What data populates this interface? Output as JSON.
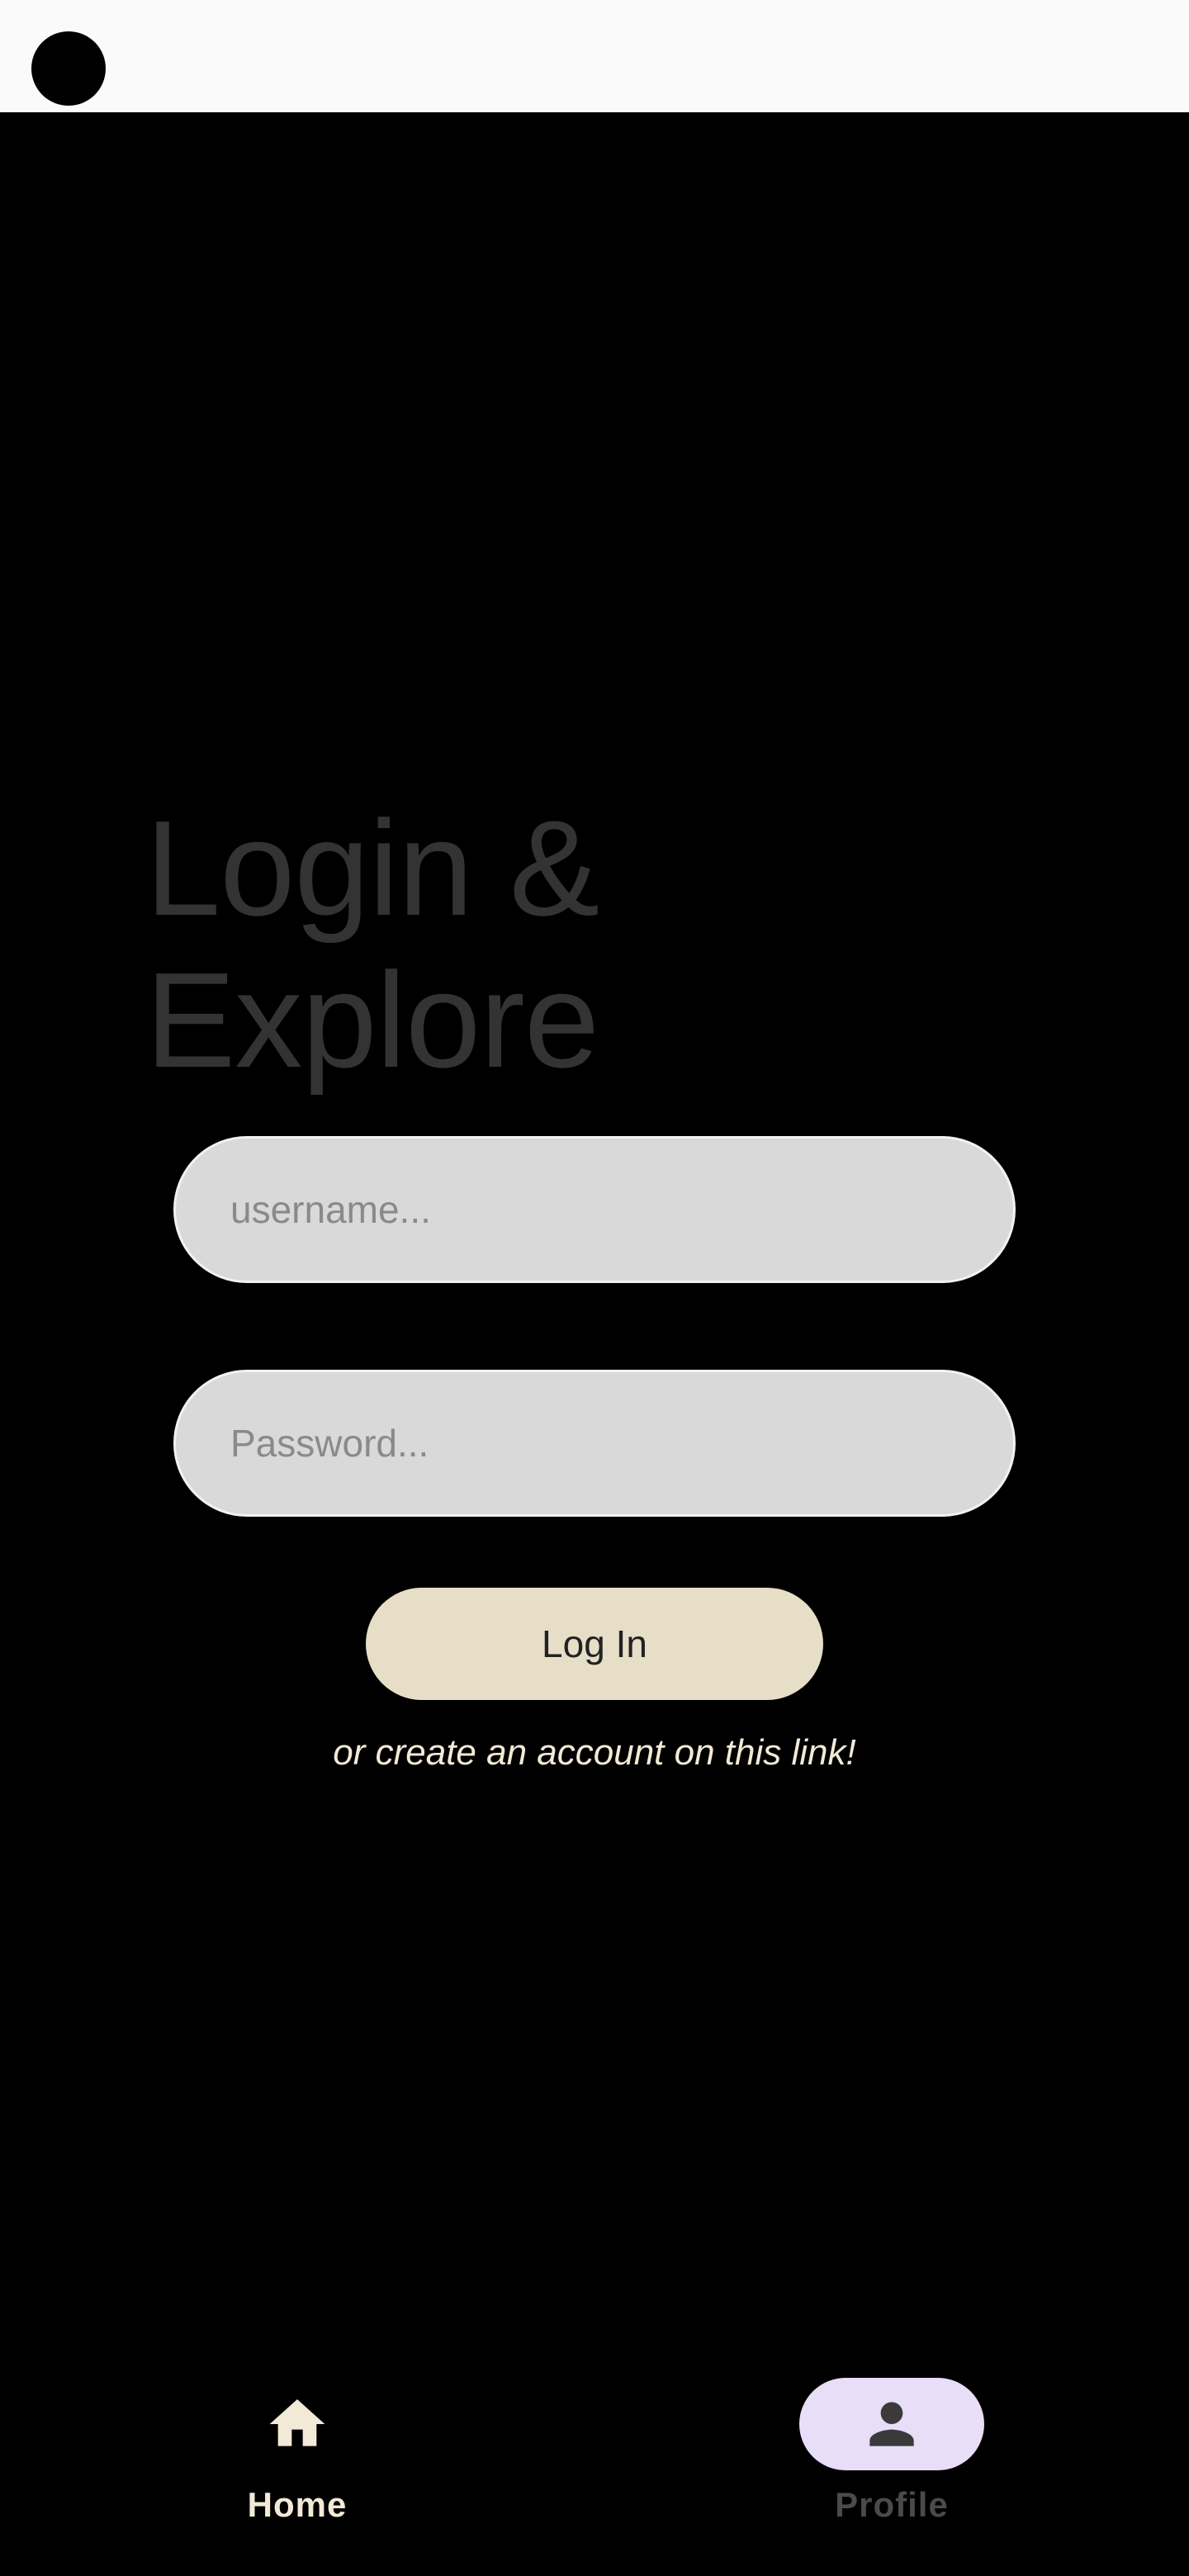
{
  "headline": {
    "line1": "Login &",
    "line2": "Explore"
  },
  "form": {
    "username_placeholder": "username...",
    "password_placeholder": "Password...",
    "login_label": "Log In",
    "signup_text": "or create an account on this link!"
  },
  "nav": {
    "items": [
      {
        "label": "Home",
        "icon": "home-icon",
        "selected": false
      },
      {
        "label": "Profile",
        "icon": "person-icon",
        "selected": true
      }
    ]
  },
  "colors": {
    "background": "#000000",
    "status_bar": "#fafafa",
    "headline": "#333333",
    "field_fill": "#d9d9d9",
    "button_fill": "#e6dec7",
    "link_text": "#f2ead6",
    "nav_active_pill": "#e8def8"
  }
}
